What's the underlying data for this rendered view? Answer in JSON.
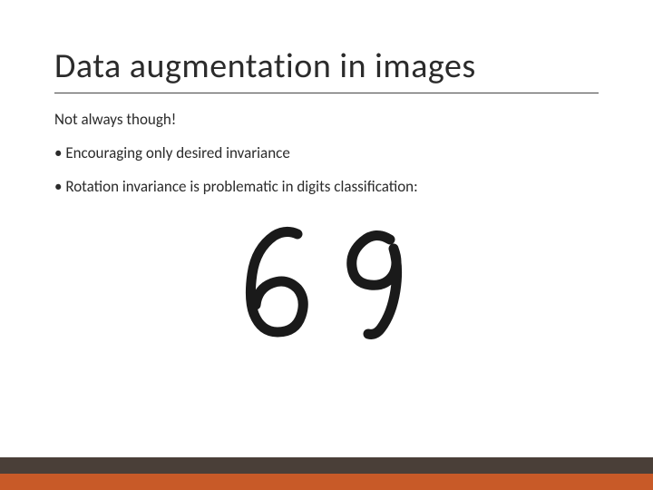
{
  "slide": {
    "title": "Data augmentation in images",
    "subtitle": "Not always though!",
    "bullets": [
      "Encouraging only desired invariance",
      "Rotation invariance is problematic in digits classification:"
    ],
    "illustration": {
      "description": "handwritten digits six and nine",
      "digits": [
        "6",
        "9"
      ]
    },
    "footer_colors": {
      "top": "#4a3f38",
      "bottom": "#c85a28"
    }
  }
}
